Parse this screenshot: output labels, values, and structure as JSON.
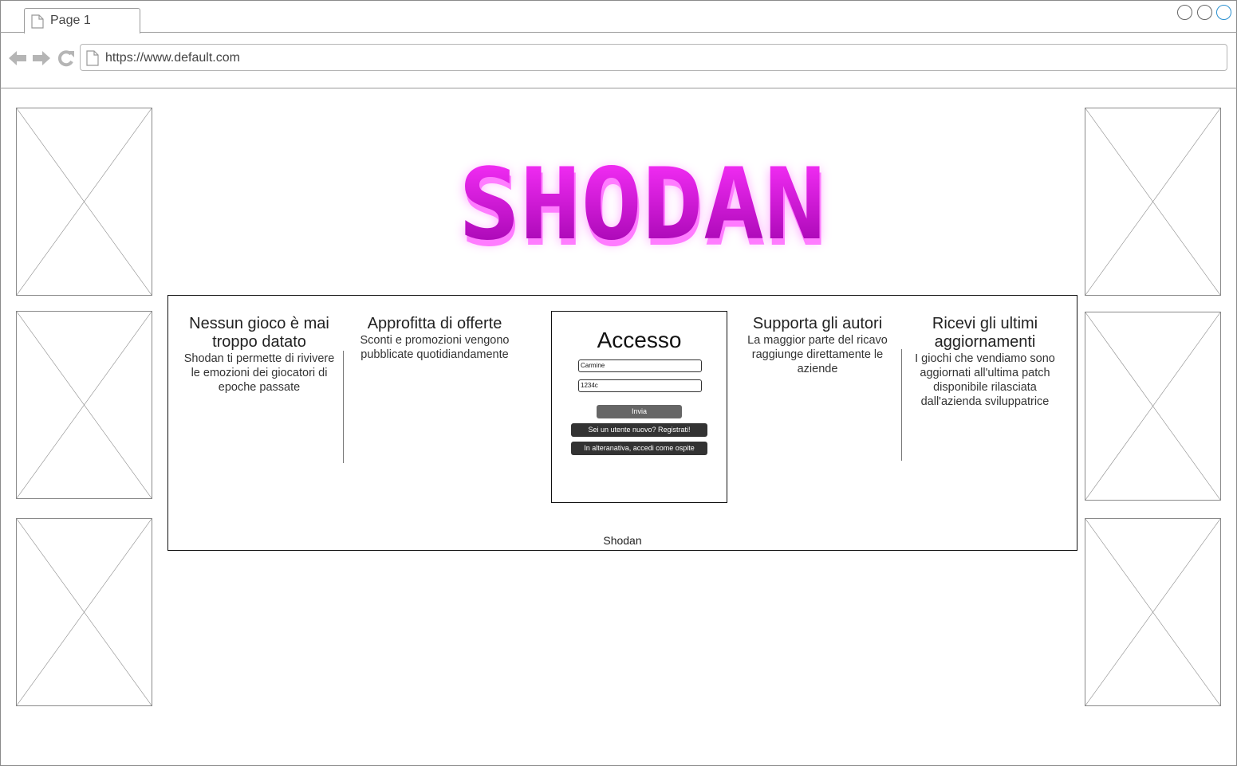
{
  "browser": {
    "tab_title": "Page 1",
    "url": "https://www.default.com"
  },
  "logo": {
    "text": "SHODAN"
  },
  "features": [
    {
      "title": "Nessun gioco è mai troppo datato",
      "desc": "Shodan ti permette di rivivere le emozioni dei giocatori di epoche passate"
    },
    {
      "title": "Approfitta di offerte",
      "desc": "Sconti e promozioni vengono pubblicate quotidiandamente"
    },
    {
      "title": "Supporta gli autori",
      "desc": "La maggior parte del ricavo raggiunge direttamente le aziende"
    },
    {
      "title": "Ricevi gli ultimi aggiornamenti",
      "desc": "I giochi che vendiamo sono aggiornati all'ultima patch disponibile rilasciata dall'azienda sviluppatrice"
    }
  ],
  "login": {
    "title": "Accesso",
    "username_value": "Carmine",
    "password_value": "1234c",
    "submit_label": "Invia",
    "register_label": "Sei un utente nuovo? Registrati!",
    "guest_label": "In alteranativa, accedi come ospite"
  },
  "footer": {
    "text": "Shodan"
  },
  "colors": {
    "logo_gradient_top": "#ff33ff",
    "logo_gradient_bottom": "#9a00a8",
    "logo_shadow": "#ff7cff",
    "button_submit": "#666666",
    "button_dark": "#333333"
  }
}
